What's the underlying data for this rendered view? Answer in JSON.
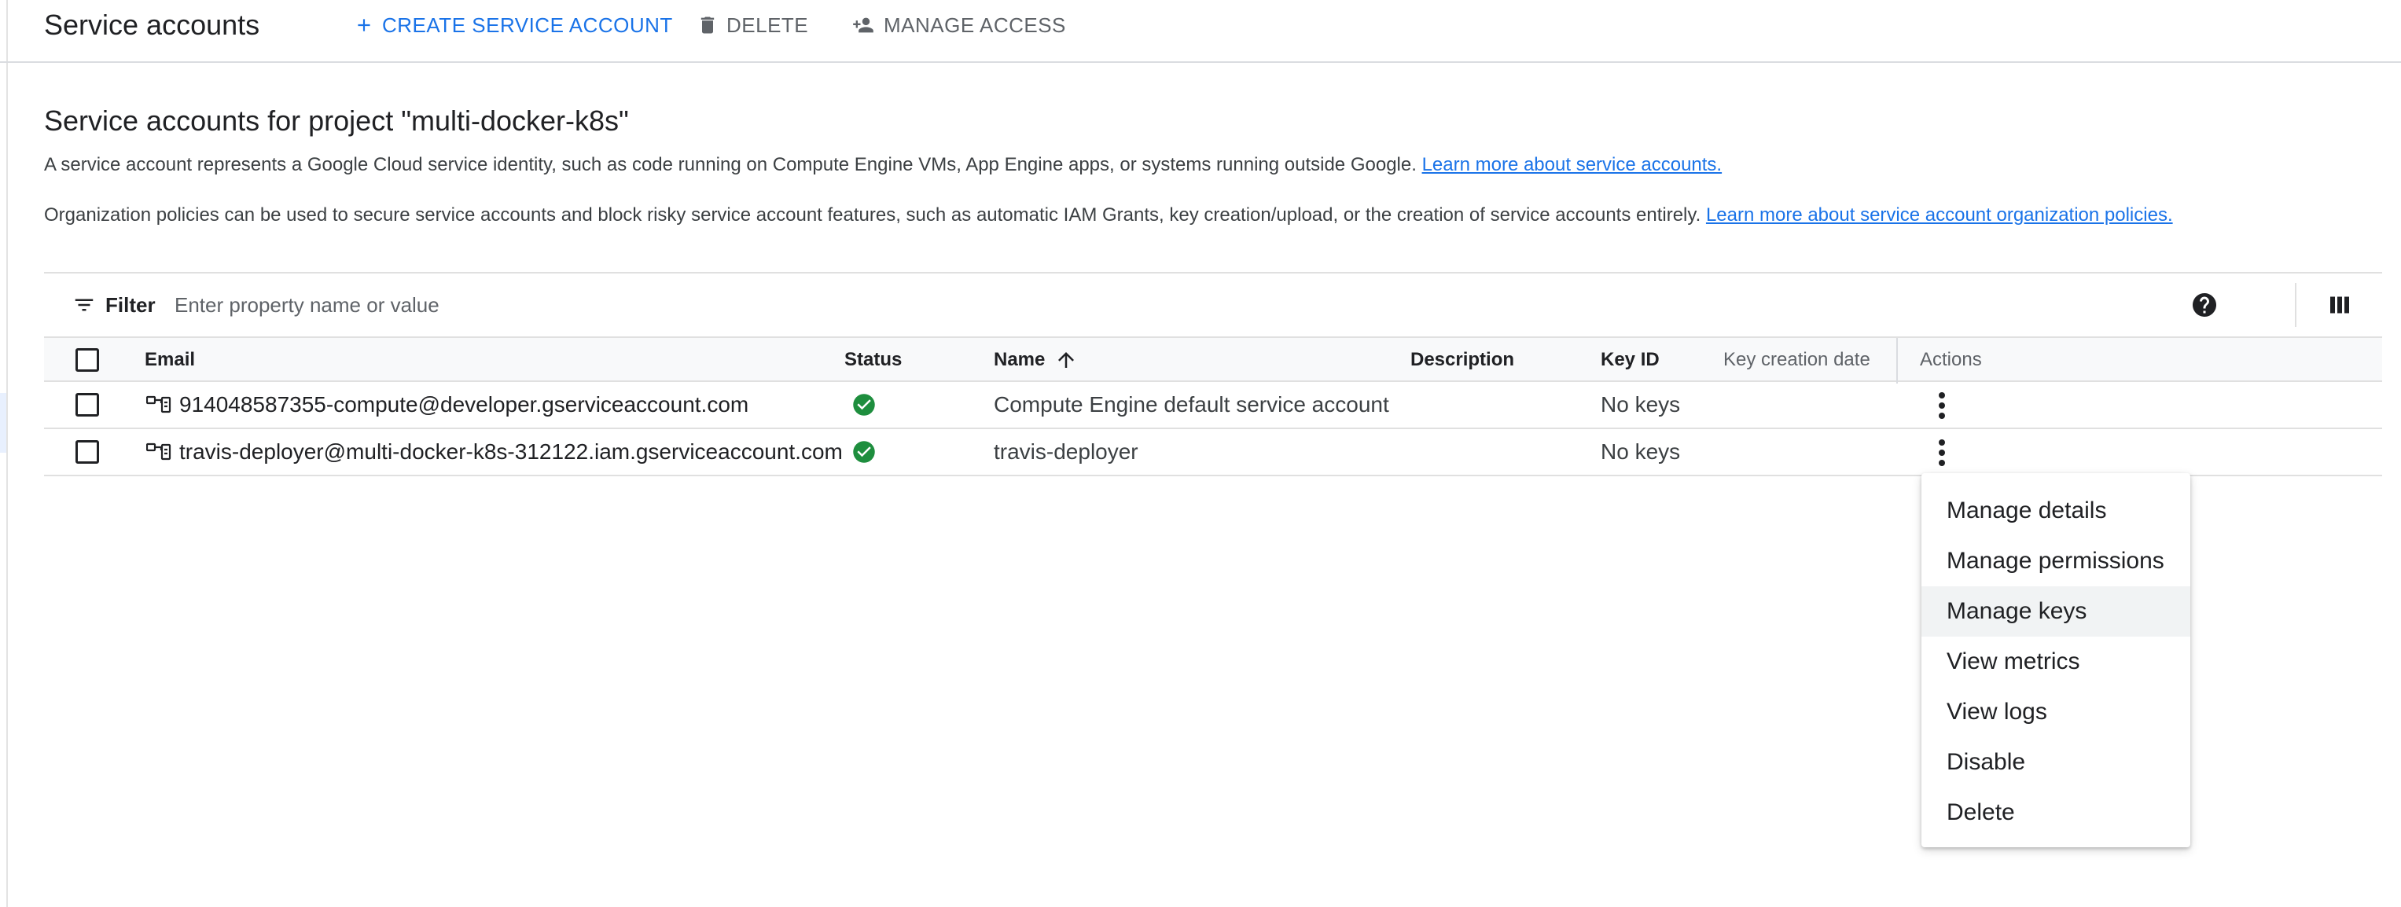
{
  "header": {
    "title": "Service accounts",
    "create_label": "CREATE SERVICE ACCOUNT",
    "delete_label": "DELETE",
    "manage_access_label": "MANAGE ACCESS",
    "accent_color": "#1a73e8"
  },
  "main": {
    "heading": "Service accounts for project \"multi-docker-k8s\"",
    "desc1_text": "A service account represents a Google Cloud service identity, such as code running on Compute Engine VMs, App Engine apps, or systems running outside Google.",
    "desc1_link": "Learn more about service accounts.",
    "desc2_text": "Organization policies can be used to secure service accounts and block risky service account features, such as automatic IAM Grants, key creation/upload, or the creation of service accounts entirely.",
    "desc2_link": "Learn more about service account organization policies."
  },
  "filter": {
    "label": "Filter",
    "placeholder": "Enter property name or value"
  },
  "table": {
    "columns": {
      "email": "Email",
      "status": "Status",
      "name": "Name",
      "description": "Description",
      "key_id": "Key ID",
      "key_creation_date": "Key creation date",
      "actions": "Actions"
    },
    "sort": {
      "column": "Name",
      "direction": "ascending"
    },
    "rows": [
      {
        "email": "914048587355-compute@developer.gserviceaccount.com",
        "status": "enabled",
        "name": "Compute Engine default service account",
        "description": "",
        "key_id": "No keys",
        "key_creation_date": ""
      },
      {
        "email": "travis-deployer@multi-docker-k8s-312122.iam.gserviceaccount.com",
        "status": "enabled",
        "name": "travis-deployer",
        "description": "",
        "key_id": "No keys",
        "key_creation_date": ""
      }
    ],
    "status_color": "#1e8e3e"
  },
  "menu": {
    "items": [
      "Manage details",
      "Manage permissions",
      "Manage keys",
      "View metrics",
      "View logs",
      "Disable",
      "Delete"
    ],
    "highlighted": "Manage keys"
  },
  "icons": {
    "create": "plus-icon",
    "delete": "trash-icon",
    "manage_access": "person-add-icon",
    "filter": "filter-list-icon",
    "help": "help-icon",
    "columns": "column-display-icon",
    "account": "service-account-key-icon",
    "status": "check-circle-icon",
    "sort": "arrow-up-icon",
    "actions": "more-vert-icon"
  }
}
